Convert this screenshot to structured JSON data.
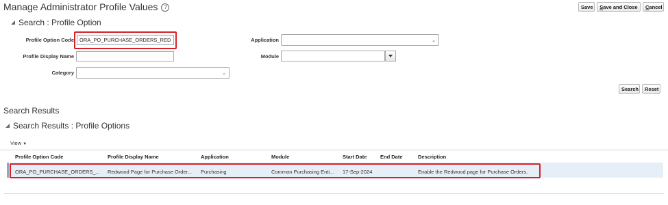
{
  "page": {
    "title": "Manage Administrator Profile Values"
  },
  "toolbar": {
    "save": "Save",
    "save_and_close_u": "S",
    "save_and_close_rest": "ave and Close",
    "cancel_u": "C",
    "cancel_rest": "ancel"
  },
  "search": {
    "heading": "Search : Profile Option",
    "profile_option_code_label": "Profile Option Code",
    "profile_option_code_value": "ORA_PO_PURCHASE_ORDERS_RED",
    "profile_display_name_label": "Profile Display Name",
    "profile_display_name_value": "",
    "category_label": "Category",
    "category_value": "",
    "application_label": "Application",
    "application_value": "",
    "module_label": "Module",
    "module_value": "",
    "search_button": "Search",
    "reset_button": "Reset"
  },
  "results": {
    "heading": "Search Results",
    "subheading": "Search Results : Profile Options",
    "view_menu": "View",
    "columns": [
      "Profile Option Code",
      "Profile Display Name",
      "Application",
      "Module",
      "Start Date",
      "End Date",
      "Description"
    ],
    "rows": [
      [
        "ORA_PO_PURCHASE_ORDERS_...",
        "Redwood Page for Purchase Order...",
        "Purchasing",
        "Common Purchasing Enti...",
        "17-Sep-2024",
        "",
        "Enable the Redwood page for Purchase Orders."
      ]
    ]
  },
  "colors": {
    "highlight": "#d81f26",
    "selected_row": "#e6eff7"
  },
  "icons": [
    "help-icon",
    "collapse-triangle-icon",
    "chevron-down-icon",
    "dropdown-arrow-icon",
    "view-menu-arrow-icon"
  ]
}
